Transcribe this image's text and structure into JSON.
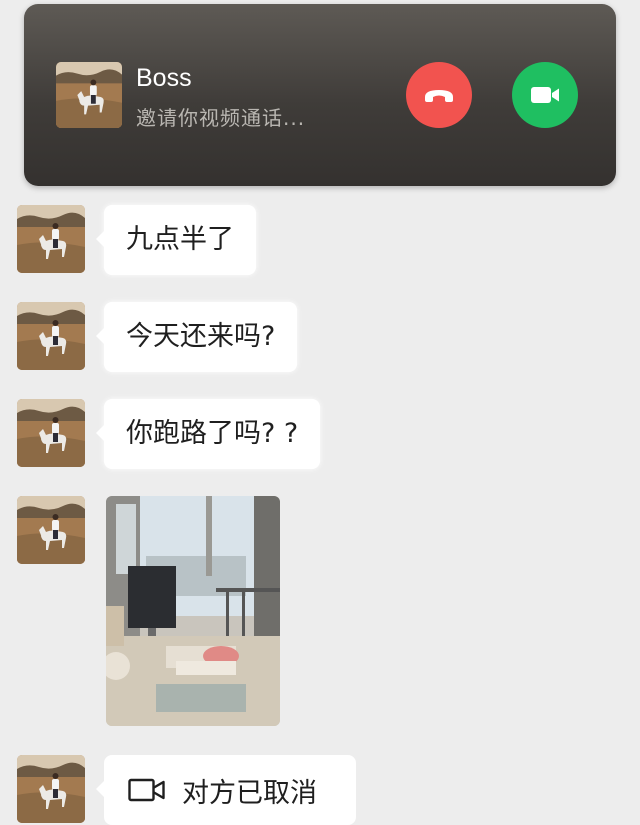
{
  "call_banner": {
    "caller_name": "Boss",
    "status_text": "邀请你视频通话...",
    "decline_icon": "hang-up-icon",
    "accept_icon": "video-camera-icon",
    "decline_color": "#f2534f",
    "accept_color": "#1fbf61"
  },
  "messages": [
    {
      "type": "text",
      "text": "九点半了"
    },
    {
      "type": "text",
      "text": "今天还来吗?"
    },
    {
      "type": "text",
      "text": "你跑路了吗? ?"
    },
    {
      "type": "image",
      "description": "office-desk-photo"
    },
    {
      "type": "call",
      "icon": "video-camera-icon",
      "text": "对方已取消"
    }
  ]
}
